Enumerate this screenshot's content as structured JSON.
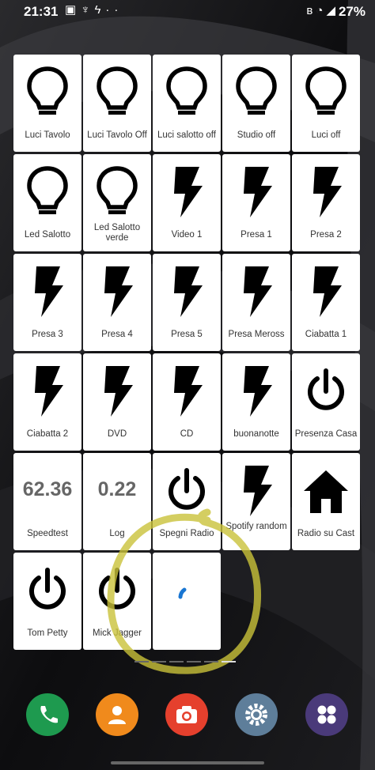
{
  "status_bar": {
    "time": "21:31",
    "battery": "27%",
    "left_icons": [
      "photo-icon",
      "usb-icon",
      "bolt-icon",
      "more-dots-icon"
    ],
    "right_icons": [
      "bluetooth-icon",
      "wifi-icon",
      "signal-icon"
    ]
  },
  "tiles": [
    {
      "label": "Luci Tavolo",
      "icon": "bulb"
    },
    {
      "label": "Luci Tavolo Off",
      "icon": "bulb"
    },
    {
      "label": "Luci salotto off",
      "icon": "bulb"
    },
    {
      "label": "Studio off",
      "icon": "bulb"
    },
    {
      "label": "Luci off",
      "icon": "bulb"
    },
    {
      "label": "Led Salotto",
      "icon": "bulb"
    },
    {
      "label": "Led Salotto verde",
      "icon": "bulb"
    },
    {
      "label": "Video 1",
      "icon": "bolt"
    },
    {
      "label": "Presa 1",
      "icon": "bolt"
    },
    {
      "label": "Presa 2",
      "icon": "bolt"
    },
    {
      "label": "Presa 3",
      "icon": "bolt"
    },
    {
      "label": "Presa 4",
      "icon": "bolt"
    },
    {
      "label": "Presa 5",
      "icon": "bolt"
    },
    {
      "label": "Presa Meross",
      "icon": "bolt"
    },
    {
      "label": "Ciabatta 1",
      "icon": "bolt"
    },
    {
      "label": "Ciabatta 2",
      "icon": "bolt"
    },
    {
      "label": "DVD",
      "icon": "bolt"
    },
    {
      "label": "CD",
      "icon": "bolt"
    },
    {
      "label": "buonanotte",
      "icon": "bolt"
    },
    {
      "label": "Presenza Casa",
      "icon": "power"
    },
    {
      "label": "Speedtest",
      "icon": "value",
      "value": "62.36"
    },
    {
      "label": "Log",
      "icon": "value",
      "value": "0.22"
    },
    {
      "label": "Spegni Radio",
      "icon": "power"
    },
    {
      "label": "Spotify random",
      "icon": "bolt"
    },
    {
      "label": "Radio su Cast",
      "icon": "home"
    },
    {
      "label": "Tom Petty",
      "icon": "power"
    },
    {
      "label": "Mick Jagger",
      "icon": "power"
    },
    {
      "label": "",
      "icon": "loading"
    }
  ],
  "dock": [
    {
      "name": "phone-app",
      "icon": "phone-icon",
      "color": "#1e9a4f"
    },
    {
      "name": "contacts-app",
      "icon": "contacts-icon",
      "color": "#f08a1c"
    },
    {
      "name": "camera-app",
      "icon": "camera-icon",
      "color": "#e5402d"
    },
    {
      "name": "settings-app",
      "icon": "gear-icon",
      "color": "#5e7e9a"
    },
    {
      "name": "apps-folder",
      "icon": "apps-icon",
      "color": "#4a3a7a"
    }
  ],
  "colors": {
    "annotation": "#c9c23a",
    "spinner": "#1976d2",
    "tile_text": "#333333",
    "value_text": "#666666"
  }
}
